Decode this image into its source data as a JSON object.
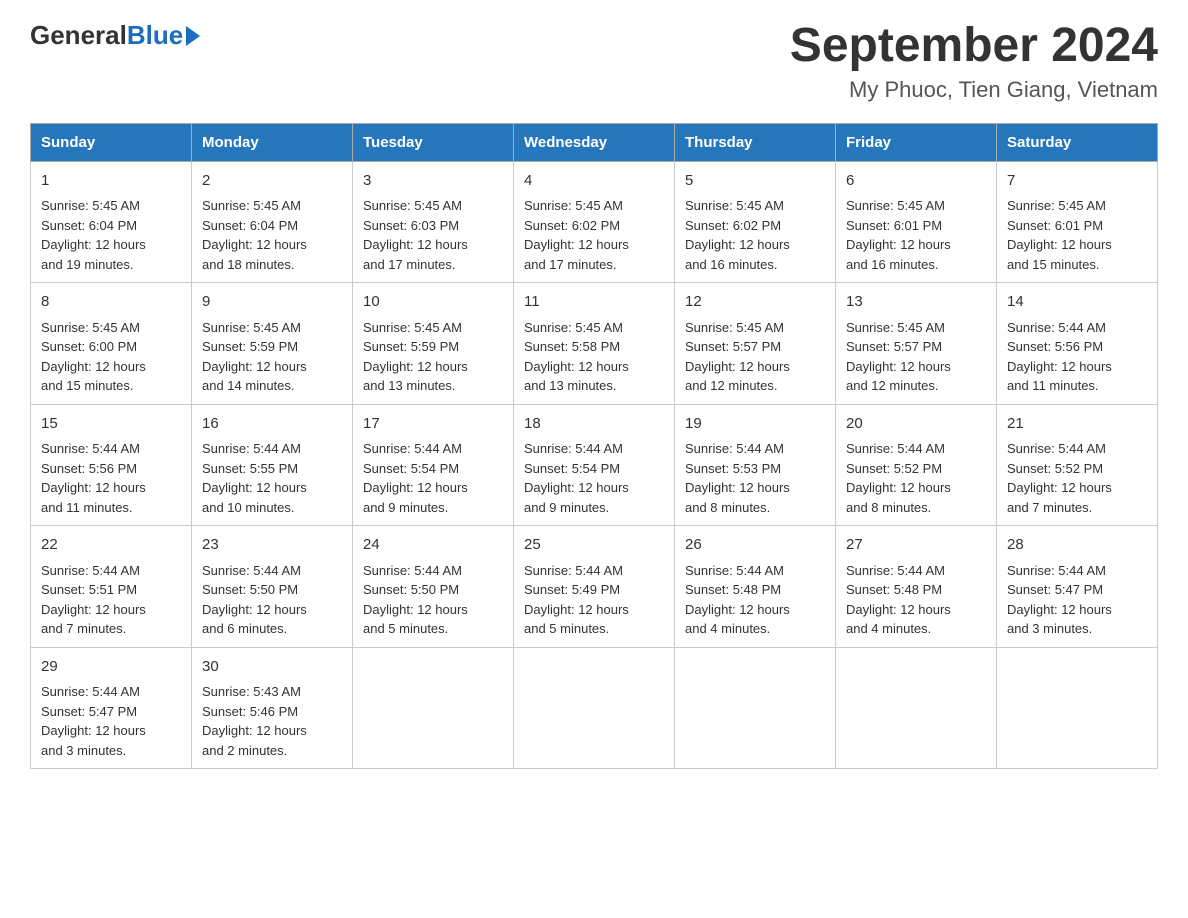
{
  "header": {
    "logo_general": "General",
    "logo_blue": "Blue",
    "month_title": "September 2024",
    "location": "My Phuoc, Tien Giang, Vietnam"
  },
  "days_of_week": [
    "Sunday",
    "Monday",
    "Tuesday",
    "Wednesday",
    "Thursday",
    "Friday",
    "Saturday"
  ],
  "weeks": [
    [
      {
        "day": "1",
        "sunrise": "5:45 AM",
        "sunset": "6:04 PM",
        "daylight": "12 hours and 19 minutes."
      },
      {
        "day": "2",
        "sunrise": "5:45 AM",
        "sunset": "6:04 PM",
        "daylight": "12 hours and 18 minutes."
      },
      {
        "day": "3",
        "sunrise": "5:45 AM",
        "sunset": "6:03 PM",
        "daylight": "12 hours and 17 minutes."
      },
      {
        "day": "4",
        "sunrise": "5:45 AM",
        "sunset": "6:02 PM",
        "daylight": "12 hours and 17 minutes."
      },
      {
        "day": "5",
        "sunrise": "5:45 AM",
        "sunset": "6:02 PM",
        "daylight": "12 hours and 16 minutes."
      },
      {
        "day": "6",
        "sunrise": "5:45 AM",
        "sunset": "6:01 PM",
        "daylight": "12 hours and 16 minutes."
      },
      {
        "day": "7",
        "sunrise": "5:45 AM",
        "sunset": "6:01 PM",
        "daylight": "12 hours and 15 minutes."
      }
    ],
    [
      {
        "day": "8",
        "sunrise": "5:45 AM",
        "sunset": "6:00 PM",
        "daylight": "12 hours and 15 minutes."
      },
      {
        "day": "9",
        "sunrise": "5:45 AM",
        "sunset": "5:59 PM",
        "daylight": "12 hours and 14 minutes."
      },
      {
        "day": "10",
        "sunrise": "5:45 AM",
        "sunset": "5:59 PM",
        "daylight": "12 hours and 13 minutes."
      },
      {
        "day": "11",
        "sunrise": "5:45 AM",
        "sunset": "5:58 PM",
        "daylight": "12 hours and 13 minutes."
      },
      {
        "day": "12",
        "sunrise": "5:45 AM",
        "sunset": "5:57 PM",
        "daylight": "12 hours and 12 minutes."
      },
      {
        "day": "13",
        "sunrise": "5:45 AM",
        "sunset": "5:57 PM",
        "daylight": "12 hours and 12 minutes."
      },
      {
        "day": "14",
        "sunrise": "5:44 AM",
        "sunset": "5:56 PM",
        "daylight": "12 hours and 11 minutes."
      }
    ],
    [
      {
        "day": "15",
        "sunrise": "5:44 AM",
        "sunset": "5:56 PM",
        "daylight": "12 hours and 11 minutes."
      },
      {
        "day": "16",
        "sunrise": "5:44 AM",
        "sunset": "5:55 PM",
        "daylight": "12 hours and 10 minutes."
      },
      {
        "day": "17",
        "sunrise": "5:44 AM",
        "sunset": "5:54 PM",
        "daylight": "12 hours and 9 minutes."
      },
      {
        "day": "18",
        "sunrise": "5:44 AM",
        "sunset": "5:54 PM",
        "daylight": "12 hours and 9 minutes."
      },
      {
        "day": "19",
        "sunrise": "5:44 AM",
        "sunset": "5:53 PM",
        "daylight": "12 hours and 8 minutes."
      },
      {
        "day": "20",
        "sunrise": "5:44 AM",
        "sunset": "5:52 PM",
        "daylight": "12 hours and 8 minutes."
      },
      {
        "day": "21",
        "sunrise": "5:44 AM",
        "sunset": "5:52 PM",
        "daylight": "12 hours and 7 minutes."
      }
    ],
    [
      {
        "day": "22",
        "sunrise": "5:44 AM",
        "sunset": "5:51 PM",
        "daylight": "12 hours and 7 minutes."
      },
      {
        "day": "23",
        "sunrise": "5:44 AM",
        "sunset": "5:50 PM",
        "daylight": "12 hours and 6 minutes."
      },
      {
        "day": "24",
        "sunrise": "5:44 AM",
        "sunset": "5:50 PM",
        "daylight": "12 hours and 5 minutes."
      },
      {
        "day": "25",
        "sunrise": "5:44 AM",
        "sunset": "5:49 PM",
        "daylight": "12 hours and 5 minutes."
      },
      {
        "day": "26",
        "sunrise": "5:44 AM",
        "sunset": "5:48 PM",
        "daylight": "12 hours and 4 minutes."
      },
      {
        "day": "27",
        "sunrise": "5:44 AM",
        "sunset": "5:48 PM",
        "daylight": "12 hours and 4 minutes."
      },
      {
        "day": "28",
        "sunrise": "5:44 AM",
        "sunset": "5:47 PM",
        "daylight": "12 hours and 3 minutes."
      }
    ],
    [
      {
        "day": "29",
        "sunrise": "5:44 AM",
        "sunset": "5:47 PM",
        "daylight": "12 hours and 3 minutes."
      },
      {
        "day": "30",
        "sunrise": "5:43 AM",
        "sunset": "5:46 PM",
        "daylight": "12 hours and 2 minutes."
      },
      null,
      null,
      null,
      null,
      null
    ]
  ]
}
